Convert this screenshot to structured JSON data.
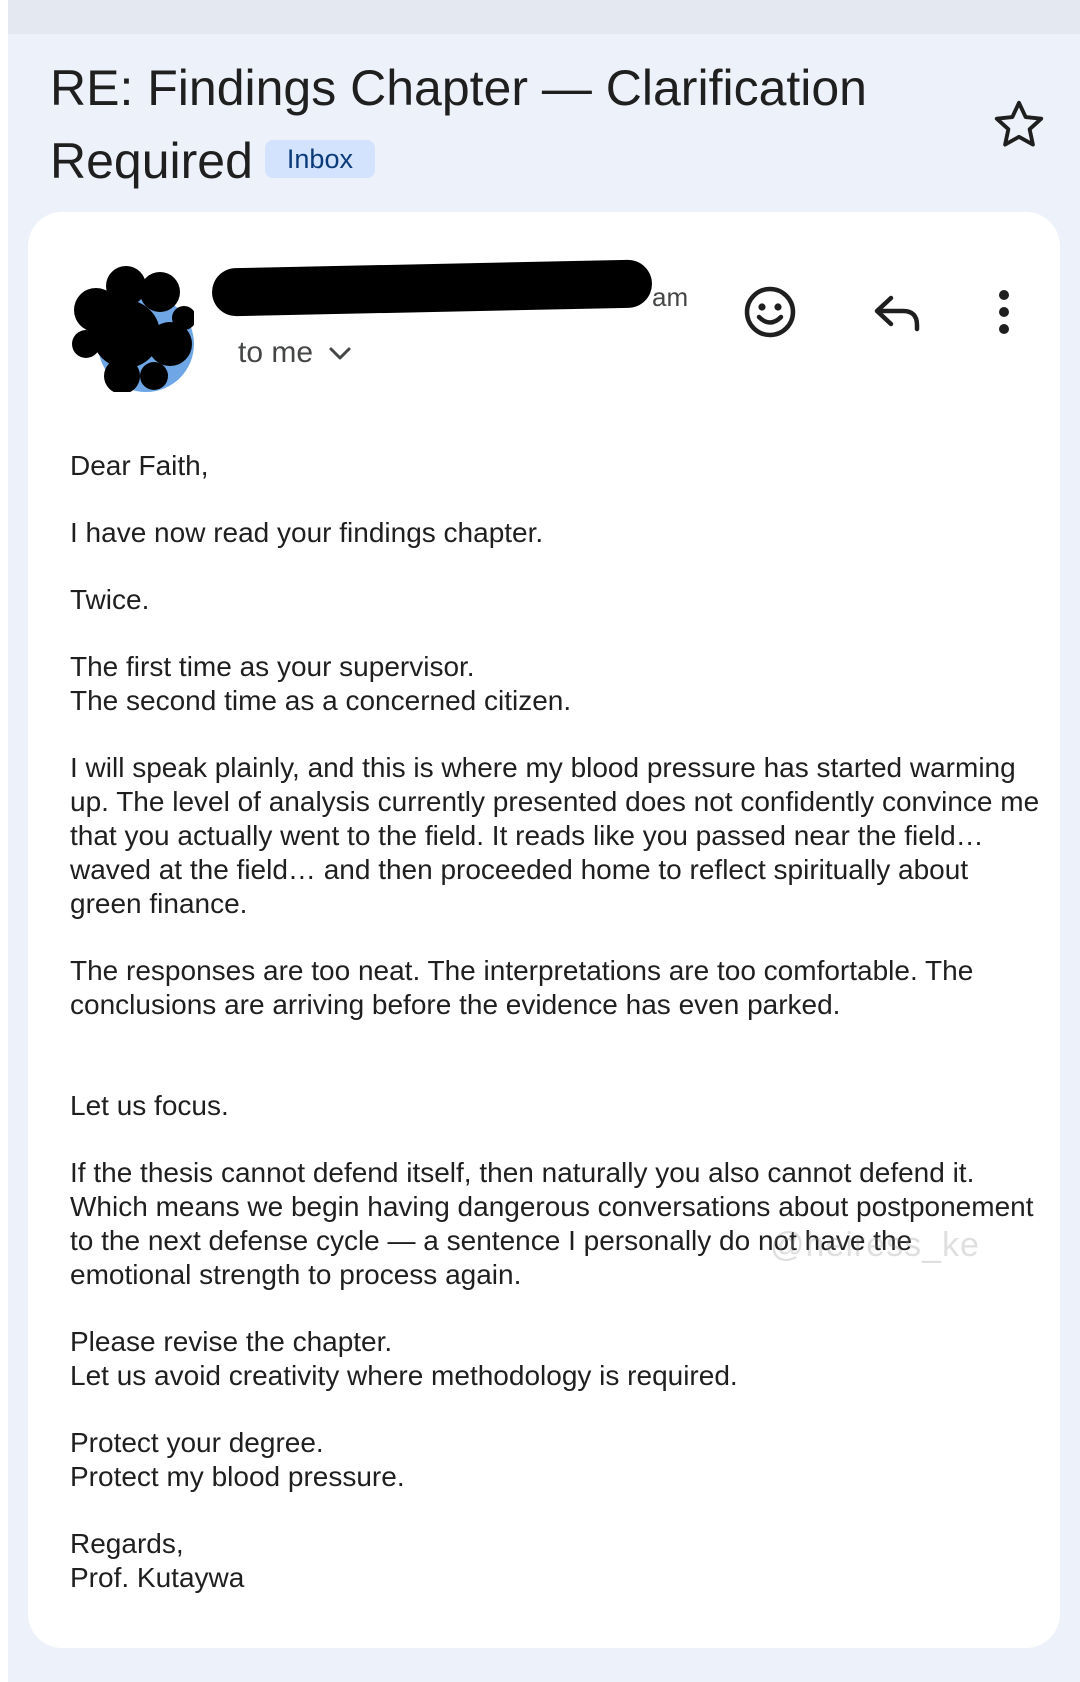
{
  "email": {
    "subject": "RE: Findings Chapter — Clarification Required",
    "label": "Inbox",
    "sender_tail": "am",
    "recipient": "to me",
    "paragraphs": [
      "Dear Faith,",
      "I have now read your findings chapter.",
      "Twice.",
      "The first time as your supervisor.\nThe second time as a concerned citizen.",
      "I will speak plainly, and this is where my blood pressure has started warming up. The level of analysis currently presented does not confidently convince me that you actually went to the field. It reads like you passed near the field… waved at the field… and then proceeded home to reflect spiritually about green finance.",
      "The responses are too neat. The interpretations are too comfortable. The conclusions are arriving before the evidence has even parked.",
      "Let us focus.",
      "If the thesis cannot defend itself, then naturally you also cannot defend it. Which means we begin having dangerous conversations about postponement to the next defense cycle — a sentence I personally do not have the emotional strength to process again.",
      "Please revise the chapter.\nLet us avoid creativity where methodology is required.",
      "Protect your degree.\nProtect my blood pressure.",
      "Regards,\nProf. Kutaywa"
    ]
  },
  "watermark": "@heiress_ke",
  "icons": {
    "star": "star-outline-icon",
    "emoji": "add-reaction-icon",
    "reply": "reply-icon",
    "more": "more-vert-icon",
    "expand": "chevron-down-icon"
  },
  "colors": {
    "background": "#edf1f9",
    "card": "#ffffff",
    "badge_bg": "#d3e3fd",
    "badge_text": "#0b3a7a",
    "avatar_blue": "#6ea6e6",
    "redaction": "#000000"
  }
}
